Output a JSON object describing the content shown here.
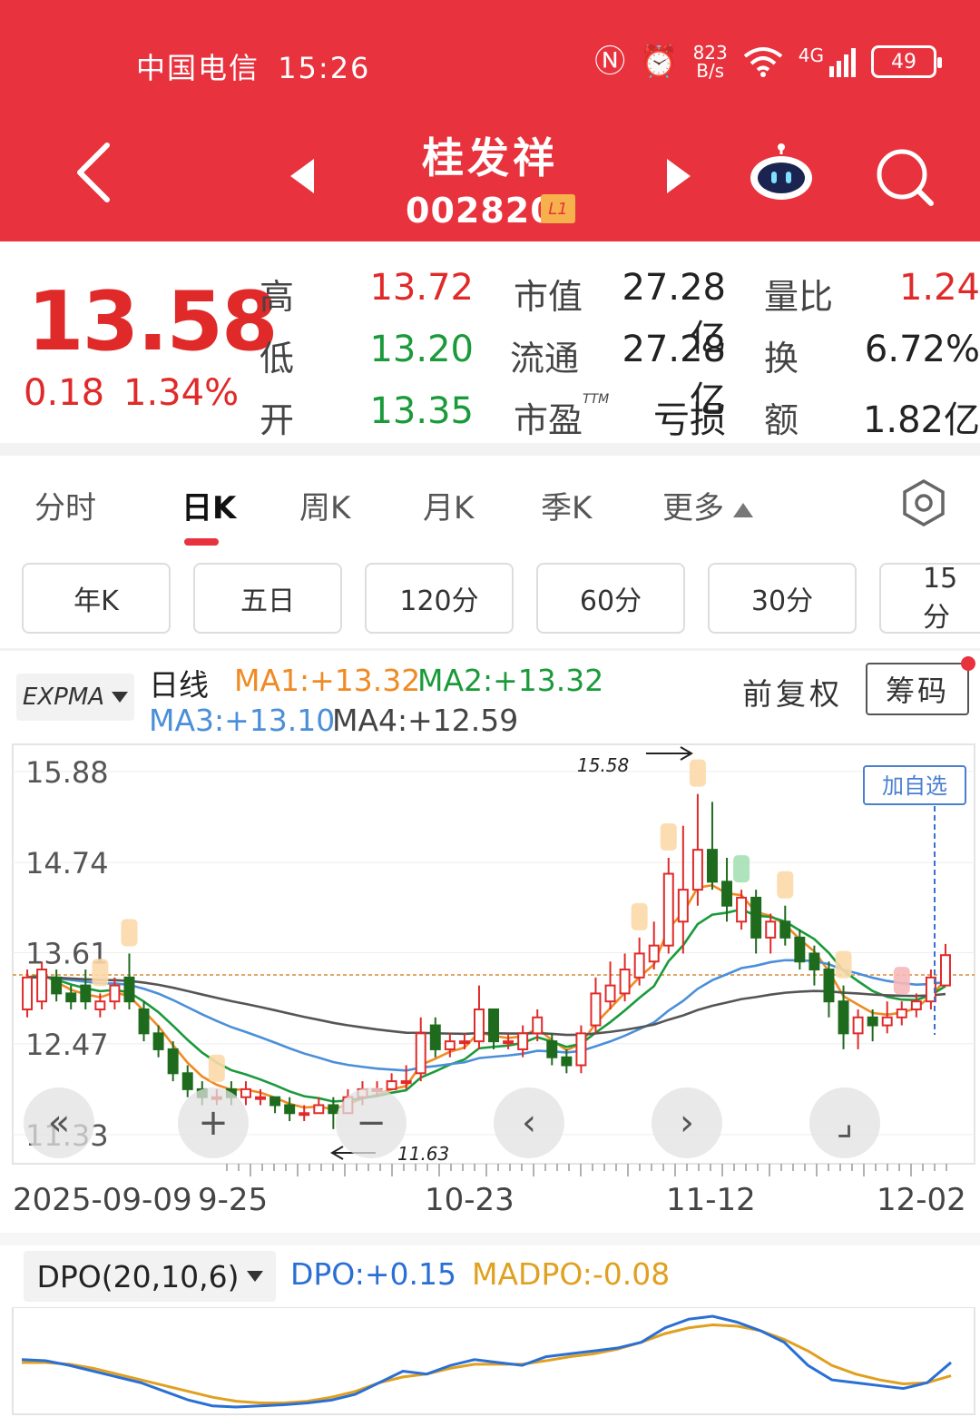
{
  "status_bar": {
    "carrier": "中国电信",
    "time": "15:26",
    "speed_top": "823",
    "speed_bottom": "B/s",
    "network": "4G",
    "battery": "49"
  },
  "header": {
    "name": "桂发祥",
    "code": "002820",
    "level_badge": "L1"
  },
  "quote": {
    "price": "13.58",
    "change": "0.18",
    "change_pct": "1.34%",
    "high_label": "高",
    "high": "13.72",
    "low_label": "低",
    "low": "13.20",
    "open_label": "开",
    "open": "13.35",
    "mcap_label": "市值",
    "mcap": "27.28亿",
    "float_label": "流通",
    "float": "27.28亿",
    "pe_label": "市盈",
    "pe_sup": "TTM",
    "pe": "亏损",
    "vol_ratio_label": "量比",
    "vol_ratio": "1.24",
    "turnover_label": "换",
    "turnover": "6.72%",
    "amount_label": "额",
    "amount": "1.82亿"
  },
  "tabs": [
    "分时",
    "日K",
    "周K",
    "月K",
    "季K",
    "更多"
  ],
  "periods": [
    "年K",
    "五日",
    "120分",
    "60分",
    "30分",
    "15分"
  ],
  "chart_header": {
    "indicator": "EXPMA",
    "line_type": "日线",
    "ma1": "MA1:+13.32",
    "ma2": "MA2:+13.32",
    "ma3": "MA3:+13.10",
    "ma4": "MA4:+12.59",
    "adjust": "前复权",
    "chips": "筹码",
    "add_watch": "加自选"
  },
  "colors": {
    "up": "#e02a2a",
    "down": "#1e6b1e",
    "ma1": "#f08a24",
    "ma2": "#1a9a3a",
    "ma3": "#4a8fd8",
    "ma4": "#555555",
    "dpo": "#2a6fd4",
    "madpo": "#e0a020"
  },
  "chart_data": {
    "type": "candlestick",
    "y_ticks": [
      "15.88",
      "14.74",
      "13.61",
      "12.47",
      "11.33"
    ],
    "ylim": [
      11.33,
      15.88
    ],
    "x_labels": [
      "2025-09-09",
      "9-25",
      "10-23",
      "11-12",
      "12-02"
    ],
    "high_annotation": "15.58",
    "low_annotation": "11.63",
    "candles": [
      {
        "o": 12.9,
        "c": 13.3,
        "h": 13.4,
        "l": 12.8
      },
      {
        "o": 13.0,
        "c": 13.4,
        "h": 13.5,
        "l": 12.9
      },
      {
        "o": 13.3,
        "c": 13.1,
        "h": 13.4,
        "l": 13.0
      },
      {
        "o": 13.1,
        "c": 13.0,
        "h": 13.2,
        "l": 12.9
      },
      {
        "o": 13.2,
        "c": 13.0,
        "h": 13.4,
        "l": 12.9
      },
      {
        "o": 12.9,
        "c": 13.0,
        "h": 13.1,
        "l": 12.8
      },
      {
        "o": 13.0,
        "c": 13.2,
        "h": 13.3,
        "l": 12.9
      },
      {
        "o": 13.3,
        "c": 13.0,
        "h": 13.6,
        "l": 12.9
      },
      {
        "o": 12.9,
        "c": 12.6,
        "h": 13.0,
        "l": 12.5
      },
      {
        "o": 12.6,
        "c": 12.4,
        "h": 12.7,
        "l": 12.3
      },
      {
        "o": 12.4,
        "c": 12.1,
        "h": 12.5,
        "l": 12.0
      },
      {
        "o": 12.1,
        "c": 11.9,
        "h": 12.2,
        "l": 11.8
      },
      {
        "o": 11.9,
        "c": 11.8,
        "h": 12.0,
        "l": 11.7
      },
      {
        "o": 11.8,
        "c": 11.8,
        "h": 11.9,
        "l": 11.7
      },
      {
        "o": 11.9,
        "c": 11.8,
        "h": 12.0,
        "l": 11.7
      },
      {
        "o": 11.8,
        "c": 11.9,
        "h": 12.0,
        "l": 11.7
      },
      {
        "o": 11.8,
        "c": 11.8,
        "h": 11.9,
        "l": 11.7
      },
      {
        "o": 11.8,
        "c": 11.7,
        "h": 11.8,
        "l": 11.6
      },
      {
        "o": 11.7,
        "c": 11.6,
        "h": 11.8,
        "l": 11.5
      },
      {
        "o": 11.6,
        "c": 11.6,
        "h": 11.7,
        "l": 11.5
      },
      {
        "o": 11.6,
        "c": 11.7,
        "h": 11.8,
        "l": 11.6
      },
      {
        "o": 11.7,
        "c": 11.6,
        "h": 11.8,
        "l": 11.4
      },
      {
        "o": 11.6,
        "c": 11.8,
        "h": 11.9,
        "l": 11.6
      },
      {
        "o": 11.8,
        "c": 11.9,
        "h": 12.0,
        "l": 11.7
      },
      {
        "o": 11.9,
        "c": 11.9,
        "h": 12.0,
        "l": 11.8
      },
      {
        "o": 11.9,
        "c": 12.0,
        "h": 12.1,
        "l": 11.9
      },
      {
        "o": 12.0,
        "c": 12.0,
        "h": 12.2,
        "l": 11.9
      },
      {
        "o": 12.1,
        "c": 12.6,
        "h": 12.8,
        "l": 12.0
      },
      {
        "o": 12.7,
        "c": 12.4,
        "h": 12.8,
        "l": 12.3
      },
      {
        "o": 12.4,
        "c": 12.5,
        "h": 12.6,
        "l": 12.3
      },
      {
        "o": 12.5,
        "c": 12.5,
        "h": 12.6,
        "l": 12.4
      },
      {
        "o": 12.5,
        "c": 12.9,
        "h": 13.2,
        "l": 12.4
      },
      {
        "o": 12.9,
        "c": 12.5,
        "h": 12.9,
        "l": 12.4
      },
      {
        "o": 12.5,
        "c": 12.5,
        "h": 12.6,
        "l": 12.4
      },
      {
        "o": 12.4,
        "c": 12.6,
        "h": 12.7,
        "l": 12.3
      },
      {
        "o": 12.6,
        "c": 12.8,
        "h": 12.9,
        "l": 12.5
      },
      {
        "o": 12.5,
        "c": 12.3,
        "h": 12.6,
        "l": 12.2
      },
      {
        "o": 12.3,
        "c": 12.2,
        "h": 12.4,
        "l": 12.1
      },
      {
        "o": 12.2,
        "c": 12.6,
        "h": 12.7,
        "l": 12.1
      },
      {
        "o": 12.7,
        "c": 13.1,
        "h": 13.3,
        "l": 12.6
      },
      {
        "o": 13.0,
        "c": 13.2,
        "h": 13.5,
        "l": 12.9
      },
      {
        "o": 13.1,
        "c": 13.4,
        "h": 13.6,
        "l": 13.0
      },
      {
        "o": 13.3,
        "c": 13.6,
        "h": 13.8,
        "l": 13.2
      },
      {
        "o": 13.5,
        "c": 13.7,
        "h": 14.0,
        "l": 13.4
      },
      {
        "o": 13.7,
        "c": 14.6,
        "h": 14.8,
        "l": 13.6
      },
      {
        "o": 14.0,
        "c": 14.4,
        "h": 15.2,
        "l": 13.6
      },
      {
        "o": 14.4,
        "c": 14.9,
        "h": 15.6,
        "l": 14.2
      },
      {
        "o": 14.9,
        "c": 14.5,
        "h": 15.5,
        "l": 14.4
      },
      {
        "o": 14.5,
        "c": 14.2,
        "h": 14.8,
        "l": 14.0
      },
      {
        "o": 14.0,
        "c": 14.3,
        "h": 14.4,
        "l": 13.9
      },
      {
        "o": 14.3,
        "c": 13.8,
        "h": 14.4,
        "l": 13.6
      },
      {
        "o": 13.8,
        "c": 14.0,
        "h": 14.1,
        "l": 13.6
      },
      {
        "o": 14.0,
        "c": 13.8,
        "h": 14.2,
        "l": 13.7
      },
      {
        "o": 13.8,
        "c": 13.5,
        "h": 13.9,
        "l": 13.4
      },
      {
        "o": 13.6,
        "c": 13.4,
        "h": 13.7,
        "l": 13.2
      },
      {
        "o": 13.4,
        "c": 13.0,
        "h": 13.5,
        "l": 12.8
      },
      {
        "o": 13.0,
        "c": 12.6,
        "h": 13.2,
        "l": 12.4
      },
      {
        "o": 12.6,
        "c": 12.8,
        "h": 12.9,
        "l": 12.4
      },
      {
        "o": 12.8,
        "c": 12.7,
        "h": 12.9,
        "l": 12.5
      },
      {
        "o": 12.7,
        "c": 12.8,
        "h": 13.0,
        "l": 12.6
      },
      {
        "o": 12.8,
        "c": 12.9,
        "h": 13.0,
        "l": 12.7
      },
      {
        "o": 12.9,
        "c": 13.0,
        "h": 13.1,
        "l": 12.8
      },
      {
        "o": 13.0,
        "c": 13.3,
        "h": 13.4,
        "l": 12.9
      },
      {
        "o": 13.2,
        "c": 13.58,
        "h": 13.72,
        "l": 13.2
      }
    ]
  },
  "dpo_chart": {
    "indicator": "DPO(20,10,6)",
    "dpo": "DPO:+0.15",
    "madpo": "MADPO:-0.08",
    "dpo_values": [
      0.2,
      0.18,
      0.1,
      0.0,
      -0.1,
      -0.2,
      -0.35,
      -0.5,
      -0.6,
      -0.62,
      -0.6,
      -0.58,
      -0.55,
      -0.5,
      -0.4,
      -0.2,
      0.0,
      -0.05,
      0.1,
      0.2,
      0.15,
      0.1,
      0.25,
      0.3,
      0.35,
      0.4,
      0.5,
      0.75,
      0.9,
      0.95,
      0.85,
      0.7,
      0.5,
      0.1,
      -0.15,
      -0.2,
      -0.25,
      -0.3,
      -0.2,
      0.15
    ],
    "madpo_values": [
      0.15,
      0.15,
      0.12,
      0.05,
      -0.05,
      -0.15,
      -0.25,
      -0.35,
      -0.45,
      -0.52,
      -0.55,
      -0.55,
      -0.52,
      -0.45,
      -0.35,
      -0.2,
      -0.1,
      -0.05,
      0.05,
      0.12,
      0.12,
      0.12,
      0.18,
      0.25,
      0.3,
      0.38,
      0.5,
      0.65,
      0.75,
      0.8,
      0.78,
      0.7,
      0.55,
      0.35,
      0.1,
      -0.05,
      -0.15,
      -0.22,
      -0.2,
      -0.08
    ]
  }
}
